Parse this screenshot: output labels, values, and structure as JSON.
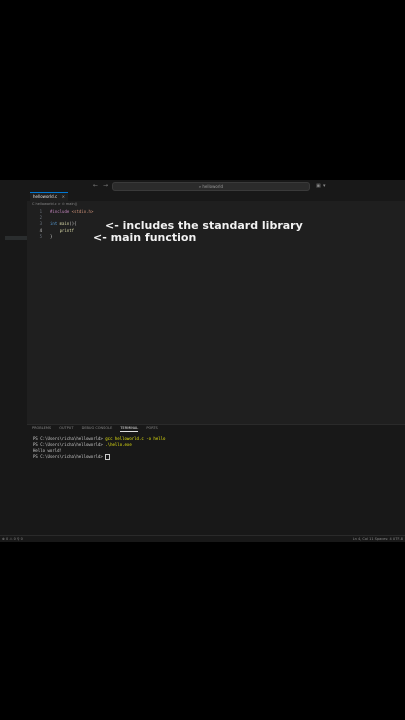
{
  "window": {
    "search_text": "⌕ helloworld",
    "back_glyph": "←",
    "forward_glyph": "→"
  },
  "editor": {
    "tab_label": "helloworld.c",
    "tab_close_glyph": "×",
    "breadcrumb": "C  helloworld.c > ⊙ main()",
    "line_numbers": [
      "1",
      "2",
      "3",
      "4",
      "5"
    ],
    "code": {
      "line1_directive": "#include",
      "line1_header": " <stdio.h>",
      "line3_type": "int",
      "line3_fn": " main",
      "line3_rest": "(){",
      "line4": "    printf",
      "line5": "}"
    }
  },
  "annotations": {
    "include_note": "<- includes the standard library",
    "main_note": "<- main function"
  },
  "panel": {
    "tabs": [
      "PROBLEMS",
      "OUTPUT",
      "DEBUG CONSOLE",
      "TERMINAL",
      "PORTS"
    ],
    "active_tab": "TERMINAL",
    "lines": {
      "l1_prompt": "PS C:\\Users\\richa\\helloworld> ",
      "l1_cmd": "gcc helloworld.c -o hello",
      "l2_prompt": "PS C:\\Users\\richa\\helloworld> ",
      "l2_cmd": ".\\hello.exe",
      "l3": "Hello world!",
      "l4_prompt": "PS C:\\Users\\richa\\helloworld> "
    }
  },
  "statusbar": {
    "left": "⊗ 0  ⚠ 0   ⚲ 0",
    "right": "Ln 4, Col 11    Spaces: 4    UTF-8"
  },
  "colors": {
    "editor_bg": "#1f1f1f",
    "accent": "#0078d4",
    "annotation_text": "#f2f2f2"
  }
}
